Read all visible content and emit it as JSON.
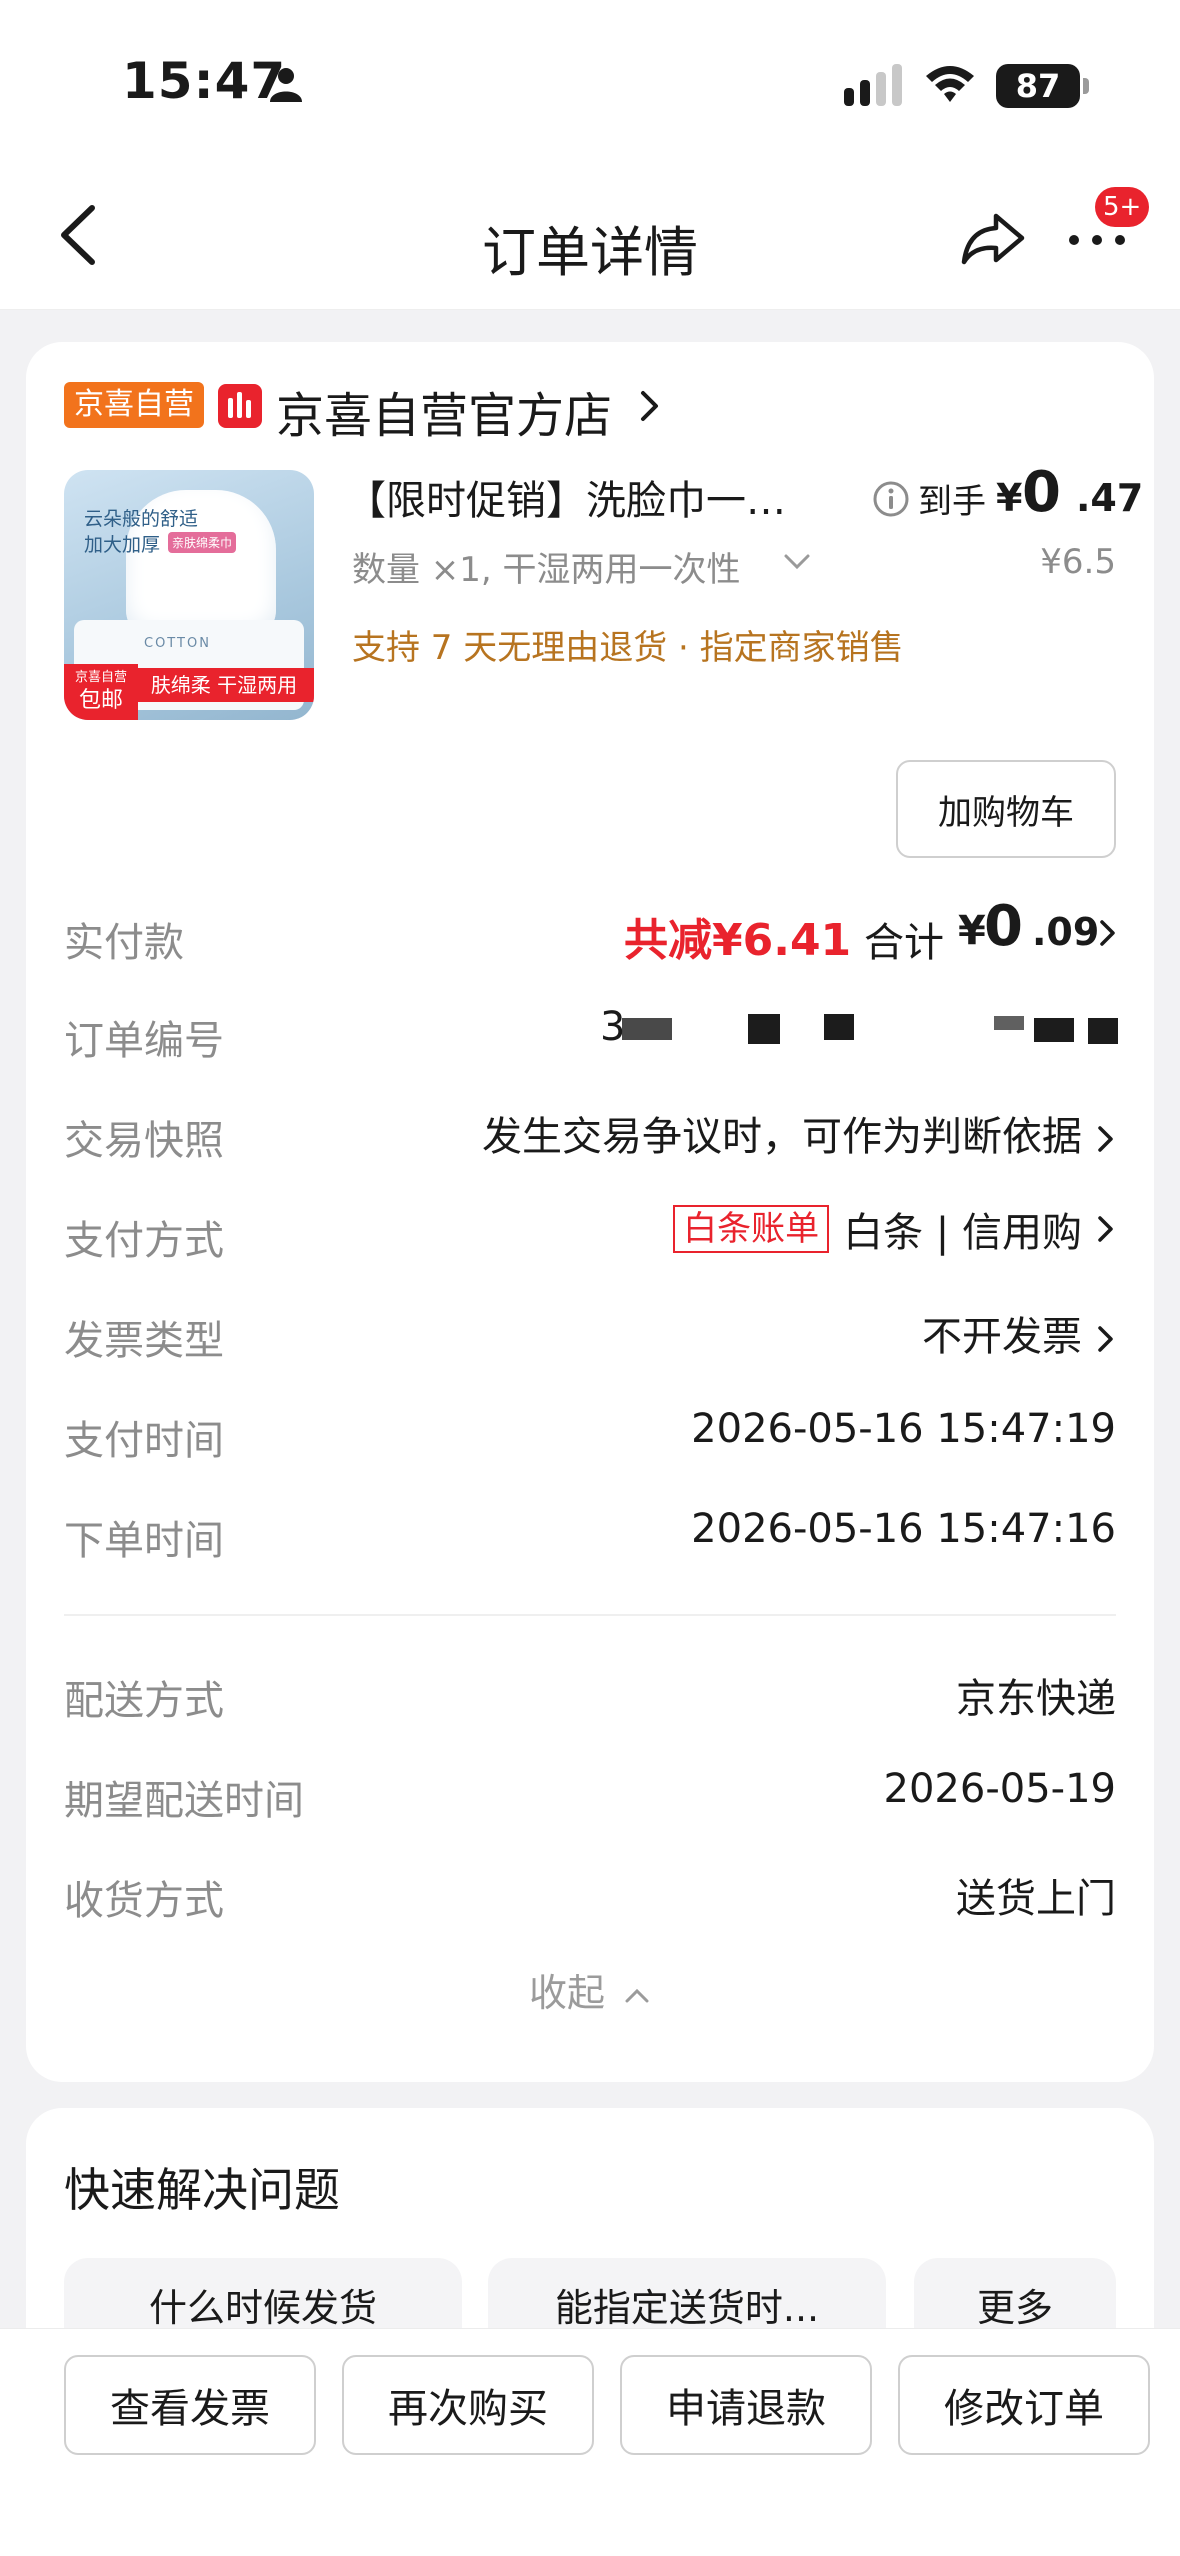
{
  "status_bar": {
    "time": "15:47",
    "battery": "87"
  },
  "nav": {
    "title": "订单详情",
    "badge": "5+"
  },
  "store": {
    "badge": "京喜自营",
    "name": "京喜自营官方店"
  },
  "product": {
    "title": "【限时促销】洗脸巾一…",
    "spec": "数量 ×1, 干湿两用一次性",
    "service": "支持 7 天无理由退货 · 指定商家销售",
    "price_label": "到手",
    "price_currency": "¥",
    "price_int": "0",
    "price_dec": ".47",
    "original_price": "¥6.5",
    "thumb_text": {
      "line1": "云朵般的舒适",
      "line2": "加大加厚",
      "tag": "亲肤绵柔巾",
      "brand": "COTTON",
      "strip": "肤绵柔 干湿两用",
      "corner1": "京喜自营",
      "corner2": "包邮"
    },
    "cart_button": "加购物车"
  },
  "payment_summary": {
    "label": "实付款",
    "reduction": "共减¥6.41",
    "total_label": "合计",
    "total_currency": "¥",
    "total_int": "0",
    "total_dec": ".09"
  },
  "details": [
    {
      "label": "订单编号",
      "value": "3"
    },
    {
      "label": "交易快照",
      "value": "发生交易争议时，可作为判断依据"
    },
    {
      "label": "支付方式",
      "tag": "白条账单",
      "value": "白条 | 信用购"
    },
    {
      "label": "发票类型",
      "value": "不开发票"
    },
    {
      "label": "支付时间",
      "value": "2026-05-16 15:47:19"
    },
    {
      "label": "下单时间",
      "value": "2026-05-16 15:47:16"
    }
  ],
  "delivery": [
    {
      "label": "配送方式",
      "value": "京东快递"
    },
    {
      "label": "期望配送时间",
      "value": "2026-05-19"
    },
    {
      "label": "收货方式",
      "value": "送货上门"
    }
  ],
  "collapse_label": "收起",
  "quick": {
    "title": "快速解决问题",
    "chips": [
      "什么时候发货",
      "能指定送货时...",
      "更多"
    ]
  },
  "bottom_buttons": [
    "查看发票",
    "再次购买",
    "申请退款",
    "修改订单"
  ],
  "icons": [
    "person-icon",
    "signal-icon",
    "wifi-icon",
    "back-icon",
    "share-icon",
    "more-icon",
    "chevron-right-icon",
    "info-icon",
    "chevron-down-icon",
    "chevron-up-icon"
  ],
  "colors": {
    "accent_red": "#e9232d",
    "service_brown": "#b77420",
    "store_orange": "#f2731c"
  }
}
